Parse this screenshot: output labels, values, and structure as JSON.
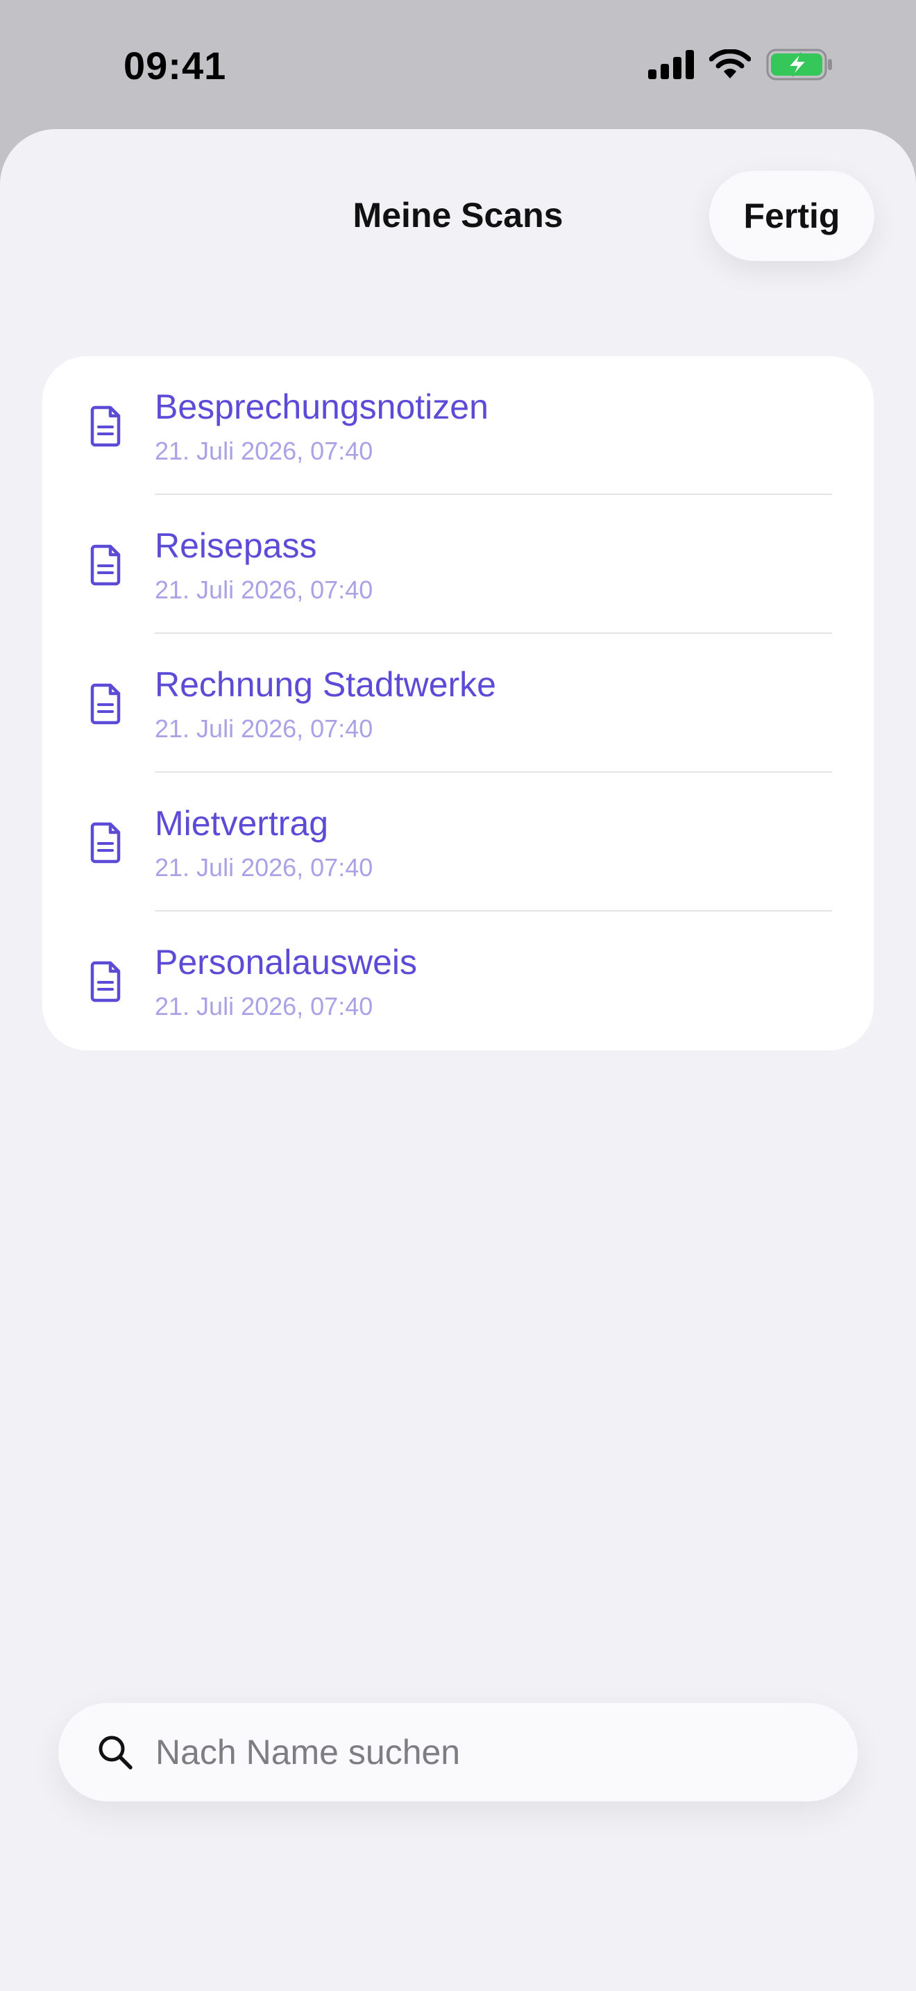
{
  "status_bar": {
    "time": "09:41"
  },
  "header": {
    "title": "Meine Scans",
    "done_label": "Fertig"
  },
  "documents": [
    {
      "name": "Besprechungsnotizen",
      "date": "21. Juli 2026, 07:40"
    },
    {
      "name": "Reisepass",
      "date": "21. Juli 2026, 07:40"
    },
    {
      "name": "Rechnung Stadtwerke",
      "date": "21. Juli 2026, 07:40"
    },
    {
      "name": "Mietvertrag",
      "date": "21. Juli 2026, 07:40"
    },
    {
      "name": "Personalausweis",
      "date": "21. Juli 2026, 07:40"
    }
  ],
  "search": {
    "placeholder": "Nach Name suchen",
    "value": ""
  },
  "icons": {
    "document": "document-icon",
    "search": "search-icon",
    "cellular": "cellular-signal-icon",
    "wifi": "wifi-icon",
    "battery": "battery-charging-icon"
  },
  "colors": {
    "accent": "#5b4bd6",
    "date": "#a9a2e6",
    "battery": "#35c759",
    "background": "#f1f1f6"
  }
}
